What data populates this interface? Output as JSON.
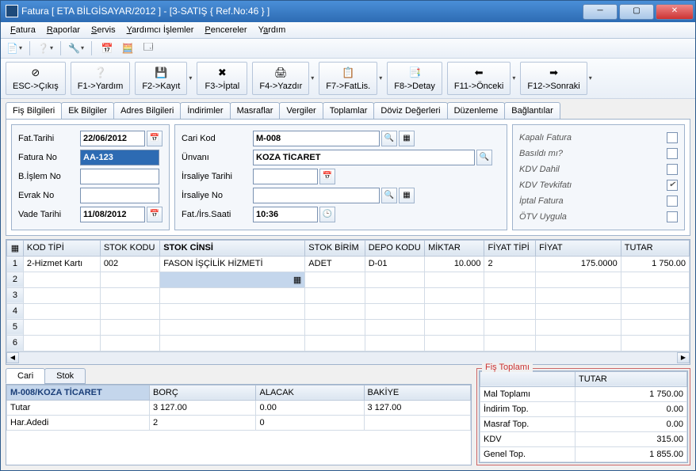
{
  "title": "Fatura [ ETA BİLGİSAYAR/2012 ]  -  [3-SATIŞ { Ref.No:46 } ]",
  "menu": [
    "Fatura",
    "Raporlar",
    "Servis",
    "Yardımcı İşlemler",
    "Pencereler",
    "Yardım"
  ],
  "actions": {
    "esc": "ESC->Çıkış",
    "f1": "F1->Yardım",
    "f2": "F2->Kayıt",
    "f3": "F3->İptal",
    "f4": "F4->Yazdır",
    "f7": "F7->FatLis.",
    "f8": "F8->Detay",
    "f11": "F11->Önceki",
    "f12": "F12->Sonraki"
  },
  "tabs": [
    "Fiş Bilgileri",
    "Ek Bilgiler",
    "Adres Bilgileri",
    "İndirimler",
    "Masraflar",
    "Vergiler",
    "Toplamlar",
    "Döviz Değerleri",
    "Düzenleme",
    "Bağlantılar"
  ],
  "left": {
    "fat_tarihi_lbl": "Fat.Tarihi",
    "fat_tarihi": "22/06/2012",
    "fatura_no_lbl": "Fatura No",
    "fatura_no": "AA-123",
    "bislem_lbl": "B.İşlem No",
    "bislem": "",
    "evrak_lbl": "Evrak No",
    "evrak": "",
    "vade_lbl": "Vade Tarihi",
    "vade": "11/08/2012"
  },
  "mid": {
    "cari_kod_lbl": "Cari Kod",
    "cari_kod": "M-008",
    "unvan_lbl": "Ünvanı",
    "unvan": "KOZA TİCARET",
    "irs_tarih_lbl": "İrsaliye Tarihi",
    "irs_tarih": "",
    "irs_no_lbl": "İrsaliye No",
    "irs_no": "",
    "saat_lbl": "Fat./İrs.Saati",
    "saat": "10:36"
  },
  "checks": {
    "kapali": "Kapalı Fatura",
    "kapali_v": false,
    "basildi": "Basıldı mı?",
    "basildi_v": false,
    "kdvdahil": "KDV Dahil",
    "kdvdahil_v": false,
    "tevkifat": "KDV Tevkifatı",
    "tevkifat_v": true,
    "iptal": "İptal Fatura",
    "iptal_v": false,
    "otv": "ÖTV Uygula",
    "otv_v": false
  },
  "grid": {
    "headers": [
      "KOD TİPİ",
      "STOK KODU",
      "STOK CİNSİ",
      "STOK BİRİM",
      "DEPO KODU",
      "MİKTAR",
      "FİYAT TİPİ",
      "FİYAT",
      "TUTAR"
    ],
    "rows": [
      {
        "kod_tipi": "2-Hizmet Kartı",
        "stok_kodu": "002",
        "stok_cinsi": "FASON İŞÇİLİK HİZMETİ",
        "birim": "ADET",
        "depo": "D-01",
        "miktar": "10.000",
        "fiyat_tipi": "2",
        "fiyat": "175.0000",
        "tutar": "1 750.00"
      }
    ]
  },
  "minitabs": [
    "Cari",
    "Stok"
  ],
  "cari_summary": {
    "title": "M-008/KOZA TİCARET",
    "headers": [
      "BORÇ",
      "ALACAK",
      "BAKİYE"
    ],
    "tutar_lbl": "Tutar",
    "tutar_borc": "3 127.00",
    "tutar_alacak": "0.00",
    "tutar_bakiye": "3 127.00",
    "adet_lbl": "Har.Adedi",
    "adet_borc": "2",
    "adet_alacak": "0",
    "adet_bakiye": ""
  },
  "totals": {
    "legend": "Fiş Toplamı",
    "header": "TUTAR",
    "mal_lbl": "Mal Toplamı",
    "mal": "1 750.00",
    "ind_lbl": "İndirim Top.",
    "ind": "0.00",
    "mas_lbl": "Masraf Top.",
    "mas": "0.00",
    "kdv_lbl": "KDV",
    "kdv": "315.00",
    "gen_lbl": "Genel Top.",
    "gen": "1 855.00"
  }
}
